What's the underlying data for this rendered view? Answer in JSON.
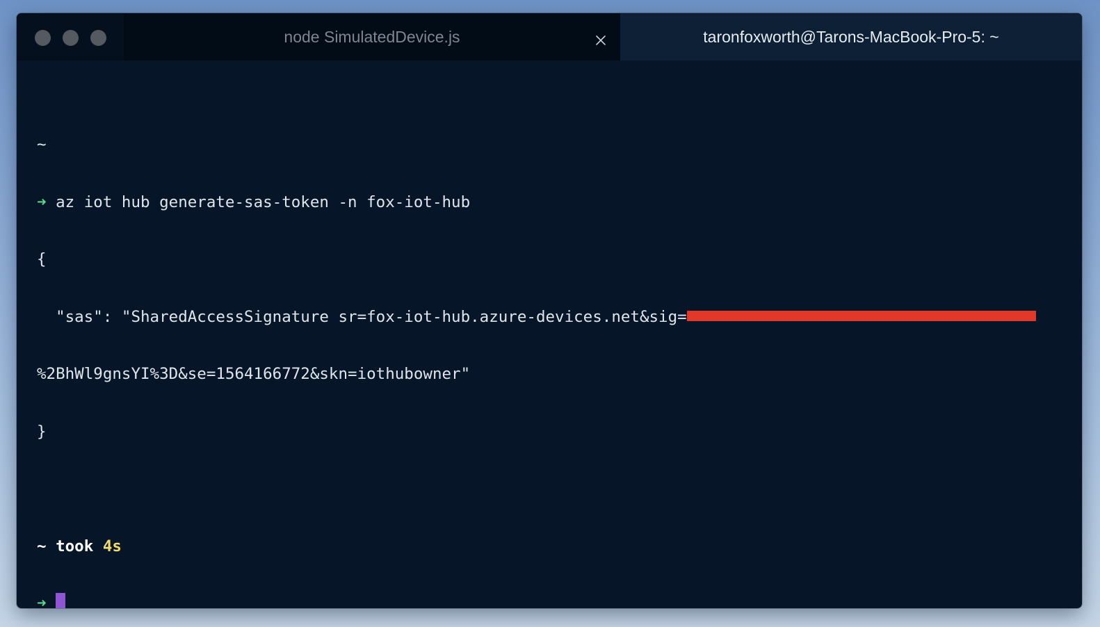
{
  "titlebar": {
    "tabs": [
      {
        "label": "node SimulatedDevice.js",
        "active": false
      },
      {
        "label": "taronfoxworth@Tarons-MacBook-Pro-5: ~",
        "active": true
      }
    ]
  },
  "terminal": {
    "prompt_symbol": "~",
    "arrow_symbol": "➜",
    "command": "az iot hub generate-sas-token -n fox-iot-hub",
    "output_open": "{",
    "output_sas_prefix": "  \"sas\": \"SharedAccessSignature sr=fox-iot-hub.azure-devices.net&sig=",
    "output_sas_continuation": "%2BhWl9gnsYI%3D&se=1564166772&skn=iothubowner\"",
    "output_close": "}",
    "took_label": "took",
    "took_duration": "4s"
  },
  "colors": {
    "background": "#061628",
    "prompt_arrow": "#5fd78a",
    "duration": "#f2da6a",
    "redaction": "#e2382a",
    "cursor": "#8e55d4"
  }
}
